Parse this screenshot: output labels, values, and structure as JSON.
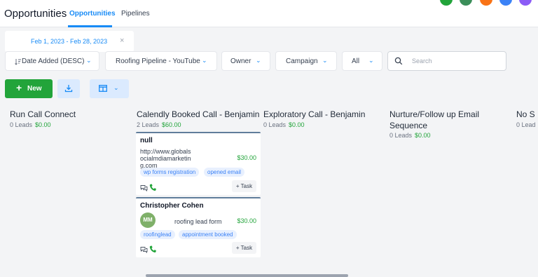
{
  "header": {
    "title": "Opportunities",
    "tabs": [
      {
        "label": "Opportunities",
        "active": true
      },
      {
        "label": "Pipelines",
        "active": false
      }
    ],
    "avatar_colors": [
      "#22a43a",
      "#3b8e5a",
      "#f97316",
      "#3b82f6",
      "#8b5cf6"
    ]
  },
  "date_filter": {
    "label": "Feb 1, 2023 - Feb 28, 2023",
    "close_glyph": "×"
  },
  "filters": {
    "sort": "Date Added (DESC)",
    "pipeline": "Roofing Pipeline - YouTube",
    "owner": "Owner",
    "campaign": "Campaign",
    "status": "All"
  },
  "search": {
    "placeholder": "Search"
  },
  "toolbar": {
    "new_label": "New",
    "new_glyph": "+"
  },
  "columns": [
    {
      "title": "Run Call Connect",
      "leads": "0 Leads",
      "amount": "$0.00"
    },
    {
      "title": "Calendly Booked Call - Benjamin",
      "leads": "2 Leads",
      "amount": "$60.00"
    },
    {
      "title": "Exploratory Call - Benjamin",
      "leads": "0 Leads",
      "amount": "$0.00"
    },
    {
      "title_line1": "Nurture/Follow up Email",
      "title_line2": "Sequence",
      "leads": "0 Leads",
      "amount": "$0.00"
    },
    {
      "title": "No S",
      "leads": "0 Lead"
    }
  ],
  "cards": [
    {
      "name": "null",
      "source_lines": [
        "http://www.globals",
        "ocialmdiamarketin",
        "g.com"
      ],
      "value": "$30.00",
      "tags": [
        "wp forms registration",
        "opened email"
      ],
      "task_label": "+ Task"
    },
    {
      "name": "Christopher Cohen",
      "avatar_initials": "MM",
      "source": "roofing lead form",
      "value": "$30.00",
      "tags": [
        "roofinglead",
        "appointment booked"
      ],
      "task_label": "+ Task"
    }
  ]
}
